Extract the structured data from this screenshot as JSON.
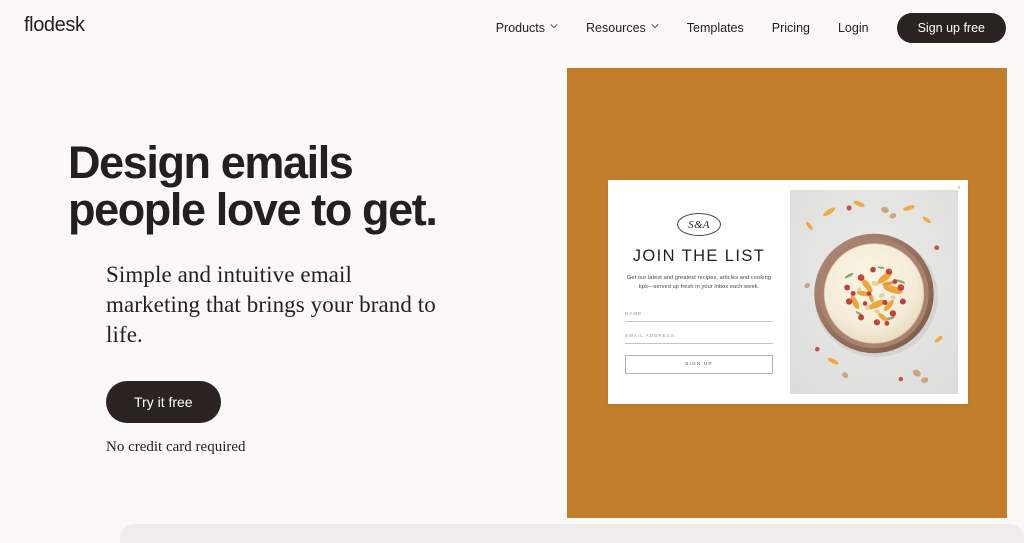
{
  "brand": {
    "logo": "flodesk",
    "accent_orange": "#c27d2a",
    "dark": "#2b2320",
    "page_bg": "#faf9f7"
  },
  "header": {
    "nav": [
      {
        "label": "Products",
        "has_chevron": true,
        "icon": "chevron-down-icon"
      },
      {
        "label": "Resources",
        "has_chevron": true,
        "icon": "chevron-down-icon"
      },
      {
        "label": "Templates",
        "has_chevron": false
      },
      {
        "label": "Pricing",
        "has_chevron": false
      },
      {
        "label": "Login",
        "has_chevron": false
      }
    ],
    "signup_label": "Sign up free"
  },
  "hero": {
    "headline_line1": "Design emails",
    "headline_line2": "people love to get.",
    "subhead": "Simple and intuitive email marketing that brings your brand to life.",
    "cta_label": "Try it free",
    "no_credit_card": "No credit card required"
  },
  "form_card": {
    "monogram": "S&A",
    "title": "JOIN THE LIST",
    "description": "Get our latest and greatest recipes, articles and cooking tips—served up fresh in your inbox each week.",
    "fields": [
      {
        "label": "NAME",
        "value": "",
        "placeholder": ""
      },
      {
        "label": "EMAIL ADDRESS",
        "value": "",
        "placeholder": ""
      }
    ],
    "submit_label": "SIGN UP",
    "close_icon": "close-icon",
    "close_glyph": "×",
    "photo_alt": "bowl-of-cream-soup-with-pomegranate-and-squash"
  }
}
